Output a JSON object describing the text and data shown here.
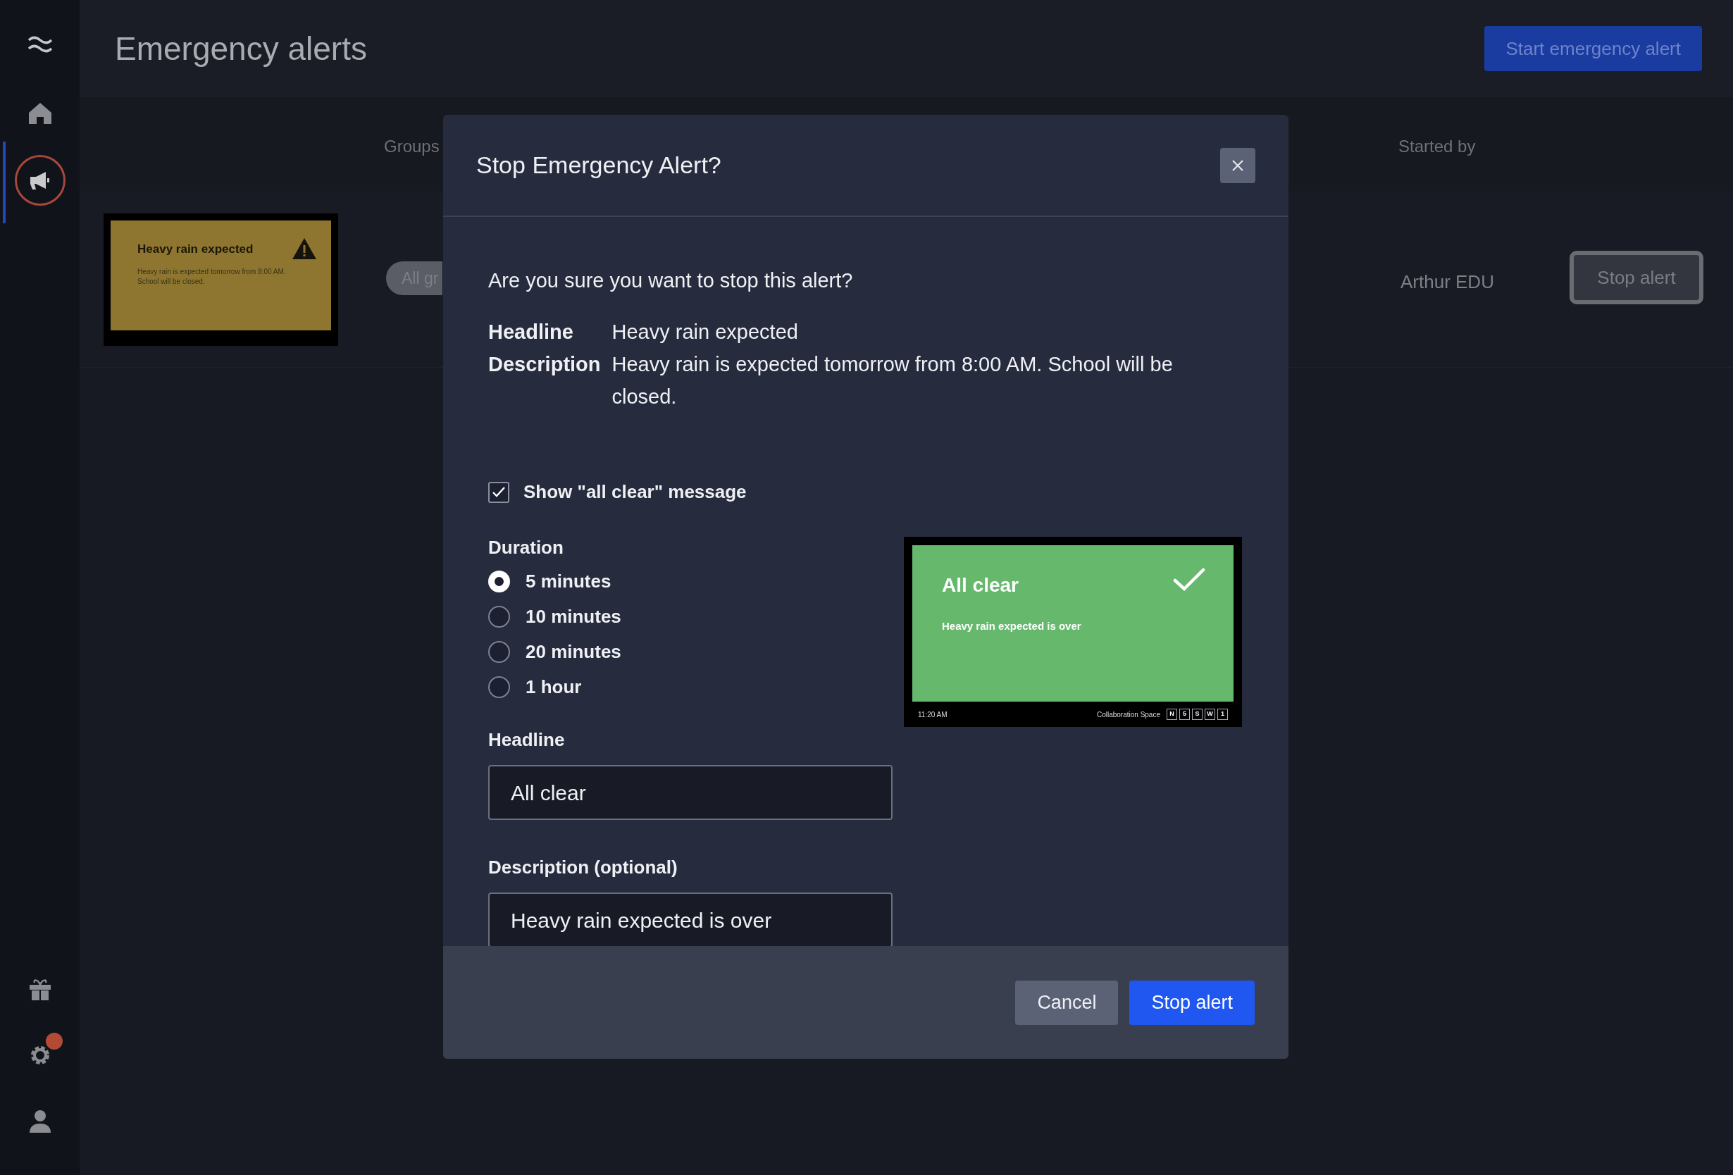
{
  "sidebar": {
    "items": [
      {
        "kind": "home",
        "selected": false,
        "notification": false
      },
      {
        "kind": "megaphone",
        "selected": true,
        "notification": false
      },
      {
        "kind": "gift",
        "selected": false,
        "notification": false
      },
      {
        "kind": "gear",
        "selected": false,
        "notification": true
      },
      {
        "kind": "user",
        "selected": false,
        "notification": false
      }
    ]
  },
  "header": {
    "title": "Emergency alerts",
    "action": "Start emergency alert"
  },
  "table": {
    "columns": [
      "Groups",
      "Started by"
    ],
    "rows": [
      {
        "thumbnail": {
          "headline": "Heavy rain expected",
          "description": "Heavy rain is expected tomorrow from 8:00 AM. School will be closed."
        },
        "groups": "All gr",
        "started_by": "Arthur EDU",
        "action": "Stop alert"
      }
    ]
  },
  "dialog": {
    "title": "Stop Emergency Alert?",
    "question": "Are you sure you want to stop this alert?",
    "details": [
      {
        "label": "Headline",
        "value": "Heavy rain expected"
      },
      {
        "label": "Description",
        "value": "Heavy rain is expected tomorrow from 8:00 AM. School will be closed."
      }
    ],
    "all_clear": {
      "label": "Show \"all clear\" message",
      "checked": true
    },
    "duration": {
      "label": "Duration",
      "options": [
        {
          "label": "5 minutes",
          "selected": true
        },
        {
          "label": "10 minutes",
          "selected": false
        },
        {
          "label": "20 minutes",
          "selected": false
        },
        {
          "label": "1 hour",
          "selected": false
        }
      ]
    },
    "preview": {
      "headline": "All clear",
      "description": "Heavy rain expected is over",
      "time": "11:20 AM",
      "location": "Collaboration Space",
      "keys": [
        "N",
        "5",
        "S",
        "W",
        "1"
      ]
    },
    "headline_field": {
      "label": "Headline",
      "value": "All clear"
    },
    "description_field": {
      "label": "Description (optional)",
      "value": "Heavy rain expected is over"
    },
    "buttons": [
      {
        "label": "Cancel",
        "kind": "secondary"
      },
      {
        "label": "Stop alert",
        "kind": "primary"
      }
    ]
  }
}
